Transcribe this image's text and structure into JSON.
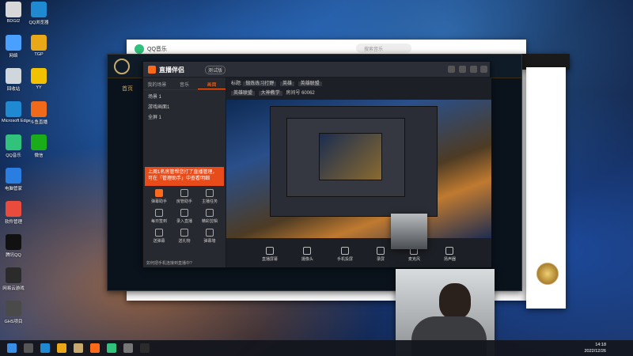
{
  "desktop": {
    "icons": [
      {
        "label": "BDGI2",
        "color": "#d8d8d8"
      },
      {
        "label": "网络",
        "color": "#4aa0ff"
      },
      {
        "label": "回收站",
        "color": "#cfd6dc"
      },
      {
        "label": "Microsoft Edge",
        "color": "#1f8ad2"
      },
      {
        "label": "QQ音乐",
        "color": "#31c27c"
      },
      {
        "label": "电脑管家",
        "color": "#2a7de1"
      },
      {
        "label": "软件管理",
        "color": "#e94b3c"
      },
      {
        "label": "腾讯QQ",
        "color": "#111111"
      },
      {
        "label": "网易云游戏",
        "color": "#2b2b2b"
      },
      {
        "label": "GHS项目",
        "color": "#4a4a4a"
      }
    ],
    "icons_col2": [
      {
        "label": "QQ浏览器",
        "color": "#1f8ad2"
      },
      {
        "label": "TGP",
        "color": "#e8a817"
      },
      {
        "label": "YY",
        "color": "#f2c200"
      },
      {
        "label": "斗鱼直播",
        "color": "#f06a1a"
      },
      {
        "label": "微信",
        "color": "#1aad19"
      }
    ]
  },
  "qq_music": {
    "title": "QQ音乐",
    "search_placeholder": "搜索音乐"
  },
  "lol_client": {
    "tab_home": "首页",
    "ping": "354"
  },
  "live_companion": {
    "app_name": "直播伴侣",
    "version_badge": "测试版",
    "tabs": [
      "我的场景",
      "音乐",
      "画面"
    ],
    "scenes": [
      "场景 1",
      "游戏画面1",
      "全屏 1"
    ],
    "notice": "上周1名房管帮您打了直播管理，可在「管理助手」中查看明细",
    "tools": [
      {
        "label": "弹幕助手",
        "active": true
      },
      {
        "label": "房管助手",
        "active": false
      },
      {
        "label": "主播任务",
        "active": false
      },
      {
        "label": "每日签到",
        "active": false
      },
      {
        "label": "录入直播",
        "active": false
      },
      {
        "label": "精彩剪辑",
        "active": false
      },
      {
        "label": "送弹幕",
        "active": false
      },
      {
        "label": "送礼物",
        "active": false
      },
      {
        "label": "弹幕墙",
        "active": false
      }
    ],
    "bottom_tip": "如何把手机连接到直播中?",
    "info": {
      "title_label": "标题:",
      "title_value": "锻炼练习打野",
      "tag1": "英雄",
      "tag2": "英雄联盟",
      "category": "英雄联盟",
      "subcategory": "大神教学",
      "room_label": "房间号",
      "room_value": "60062"
    },
    "controls": [
      "直播屏幕",
      "摄像头",
      "手机投屏",
      "录屏",
      "麦克风",
      "扬声器"
    ]
  },
  "taskbar": {
    "time": "14:18",
    "date": "2022/12/26"
  }
}
